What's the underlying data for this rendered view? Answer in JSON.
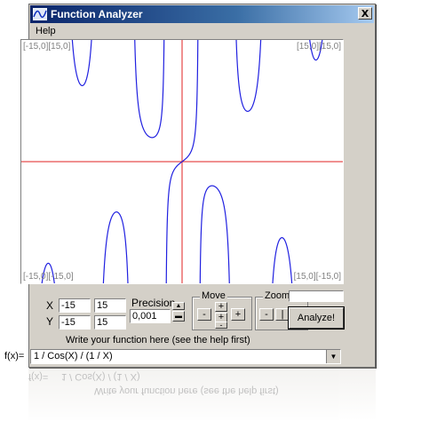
{
  "window": {
    "title": "Function Analyzer",
    "close_symbol": "X"
  },
  "menu": {
    "help": "Help"
  },
  "plot": {
    "corner_top_left": "[-15,0][15,0]",
    "corner_top_right": "[15,0][15,0]",
    "corner_bottom_left": "[-15,0][-15,0]",
    "corner_bottom_right": "[15,0][-15,0]",
    "axis_color": "#e02020",
    "curve_color": "#2020e0"
  },
  "ranges": {
    "x_label": "X",
    "y_label": "Y",
    "x_min": "-15",
    "x_max": "15",
    "y_min": "-15",
    "y_max": "15"
  },
  "precision": {
    "label": "Precision",
    "value": "0,001"
  },
  "move": {
    "label": "Move",
    "left": "-",
    "right": "+",
    "up": "+",
    "center": "+",
    "down": "-"
  },
  "zoom": {
    "label": "Zoom",
    "out": "-",
    "reset": "|",
    "in": "+"
  },
  "progress": {
    "value": 0
  },
  "analyze": {
    "label": "Analyze!"
  },
  "function": {
    "prompt": "Write your function here (see the help first)",
    "label": "f(x)=",
    "value": "1 / Cos(X) / (1 / X)"
  }
}
